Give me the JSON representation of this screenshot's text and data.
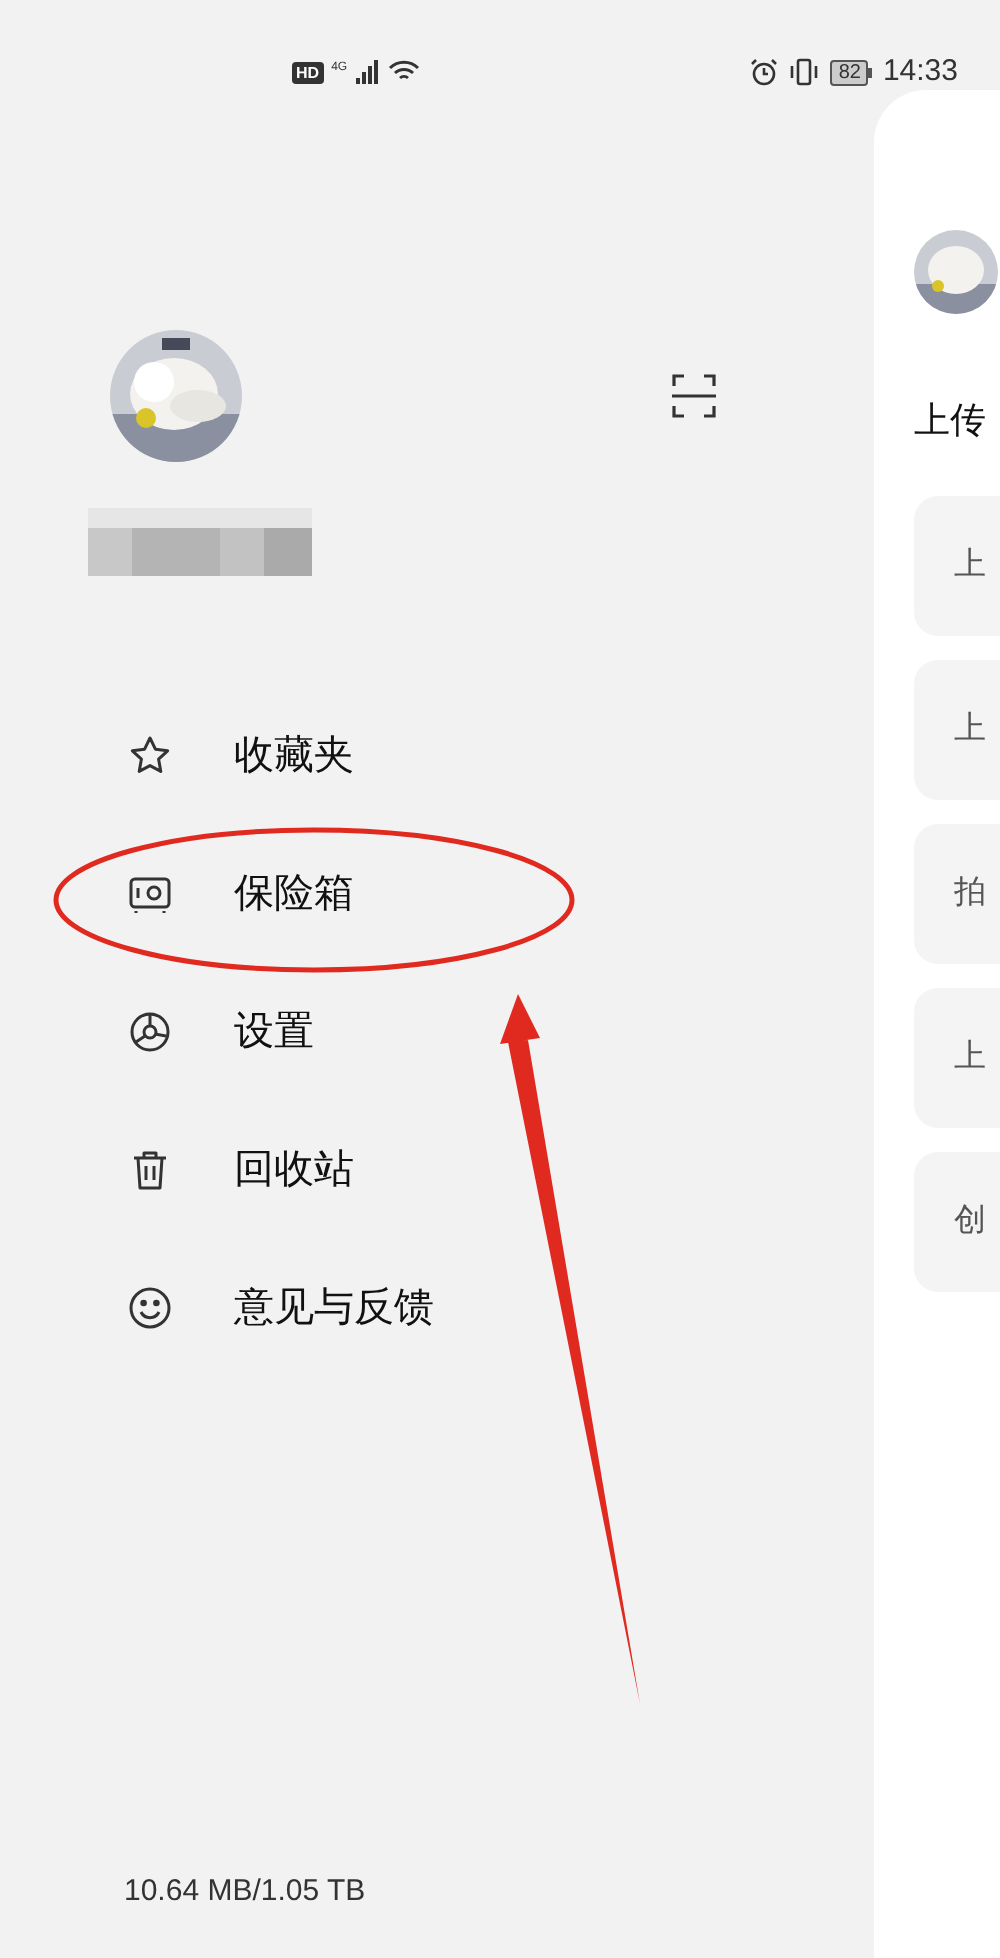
{
  "status_bar": {
    "left": [
      "HD",
      "4G"
    ],
    "battery": "82",
    "time": "14:33"
  },
  "drawer": {
    "menu": [
      {
        "label": "收藏夹"
      },
      {
        "label": "保险箱"
      },
      {
        "label": "设置"
      },
      {
        "label": "回收站"
      },
      {
        "label": "意见与反馈"
      }
    ],
    "storage": "10.64 MB/1.05 TB"
  },
  "main_panel": {
    "title": "上传",
    "cards": [
      "上",
      "上",
      "拍",
      "上",
      "创"
    ]
  },
  "annotations": {
    "ellipse": true,
    "arrow": true
  }
}
